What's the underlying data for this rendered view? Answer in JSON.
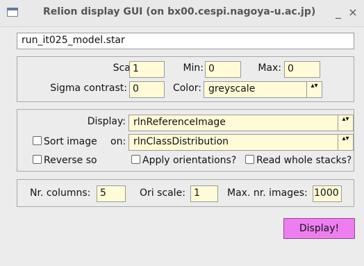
{
  "window": {
    "title": "Relion display GUI (on bx00.cespi.nagoya-u.ac.jp)",
    "minimize_glyph": "_",
    "close_glyph": "×"
  },
  "file": {
    "value": "run_it025_model.star"
  },
  "scale_group": {
    "scale_label": "Scale:",
    "scale_value": "1",
    "min_label": "Min:",
    "min_value": "0",
    "max_label": "Max:",
    "max_value": "0",
    "sigma_label": "Sigma contrast:",
    "sigma_value": "0",
    "color_label": "Color:",
    "color_value": "greyscale"
  },
  "display_group": {
    "display_label": "Display:",
    "display_value": "rlnReferenceImage",
    "sort_label": "Sort image",
    "sort_checked": false,
    "on_label": "on:",
    "sort_value": "rlnClassDistribution",
    "reverse_label": "Reverse so",
    "reverse_checked": false,
    "apply_label": "Apply orientations?",
    "apply_checked": false,
    "read_label": "Read whole stacks?",
    "read_checked": false
  },
  "columns_group": {
    "nr_columns_label": "Nr. columns:",
    "nr_columns_value": "5",
    "ori_scale_label": "Ori scale:",
    "ori_scale_value": "1",
    "max_images_label": "Max. nr. images:",
    "max_images_value": "1000"
  },
  "display_button": {
    "label": "Display!"
  },
  "colors": {
    "field_bg": "#fffbd6",
    "button_bg": "#ee7ef0",
    "window_bg": "#ececec"
  }
}
